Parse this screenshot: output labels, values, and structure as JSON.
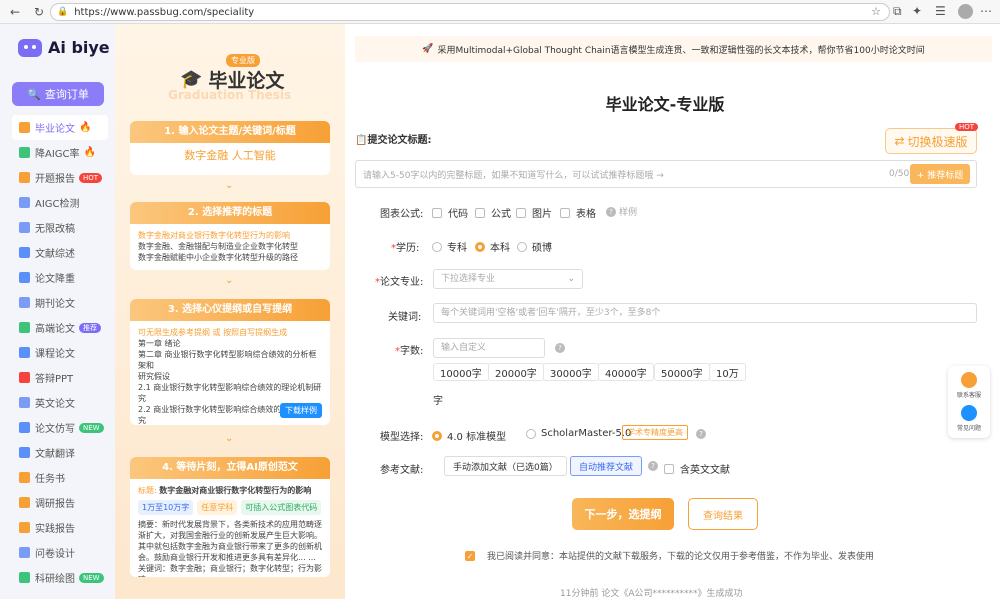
{
  "browser": {
    "url": "https://www.passbug.com/speciality"
  },
  "brand": {
    "name": "Ai biye"
  },
  "sidebar": {
    "search_button": "查询订单",
    "items": [
      {
        "label": "毕业论文",
        "badge": "fire",
        "color": "#f7a035"
      },
      {
        "label": "降AIGC率",
        "badge": "fire",
        "color": "#3cc57a"
      },
      {
        "label": "开题报告",
        "badge": "HOT",
        "color": "#f7a035"
      },
      {
        "label": "AIGC检测",
        "badge": "",
        "color": "#7b9cf6"
      },
      {
        "label": "无限改稿",
        "badge": "",
        "color": "#7b9cf6"
      },
      {
        "label": "文献综述",
        "badge": "",
        "color": "#5b8ff9"
      },
      {
        "label": "论文降重",
        "badge": "",
        "color": "#5b8ff9"
      },
      {
        "label": "期刊论文",
        "badge": "",
        "color": "#7b9cf6"
      },
      {
        "label": "高端论文",
        "badge": "推荐",
        "color": "#3cc57a"
      },
      {
        "label": "课程论文",
        "badge": "",
        "color": "#5b8ff9"
      },
      {
        "label": "答辩PPT",
        "badge": "",
        "color": "#f5443b"
      },
      {
        "label": "英文论文",
        "badge": "",
        "color": "#7b9cf6"
      },
      {
        "label": "论文仿写",
        "badge": "NEW",
        "color": "#5b8ff9"
      },
      {
        "label": "文献翻译",
        "badge": "",
        "color": "#5b8ff9"
      },
      {
        "label": "任务书",
        "badge": "",
        "color": "#f7a035"
      },
      {
        "label": "调研报告",
        "badge": "",
        "color": "#f7a035"
      },
      {
        "label": "实践报告",
        "badge": "",
        "color": "#f7a035"
      },
      {
        "label": "问卷设计",
        "badge": "",
        "color": "#7b9cf6"
      },
      {
        "label": "科研绘图",
        "badge": "NEW",
        "color": "#3cc57a"
      }
    ]
  },
  "left": {
    "badge": "专业版",
    "title": "毕业论文",
    "ghost": "Graduation Thesis",
    "step1": {
      "title": "1. 输入论文主题/关键词/标题",
      "content": "数字金融 人工智能"
    },
    "step2": {
      "title": "2. 选择推荐的标题",
      "lines": [
        "数字金融对商业银行数字化转型行为的影响",
        "数字金融、金融错配与制造业企业数字化转型",
        "数字金融赋能中小企业数字化转型升级的路径"
      ]
    },
    "step3": {
      "title": "3. 选择心仪提纲或自写提纲",
      "hint": "可无限生成参考提纲 或 按照自写提纲生成",
      "lines": [
        "第一章  绪论",
        "第二章  商业银行数字化转型影响综合绩效的分析框架和",
        "研究假设",
        "2.1 商业银行数字化转型影响综合绩效的理论机制研究",
        "2.2 商业银行数字化转型影响综合绩效的传导机制研究",
        "... ..."
      ],
      "button": "下载样例"
    },
    "step4": {
      "title": "4. 等待片刻，立得AI原创范文",
      "label": "标题:",
      "paper_title": "数字金融对商业银行数字化转型行为的影响",
      "tags": [
        "1万至10万字",
        "任意学科",
        "可插入公式图表代码"
      ],
      "abstract": "摘要：新时代发展背景下，各类新技术的应用范畴逐渐扩大，对我国金融行业的创新发展产生巨大影响。其中就包括数字金融为商业银行带来了更多的创新机会。鼓励商业银行开发和推进更多具有差异化... ...",
      "keywords": "关键词：数字金融；商业银行；数字化转型；行为影响"
    }
  },
  "main": {
    "banner": "采用Multimodal+Global Thought Chain语言模型生成连贯、一致和逻辑性强的长文本技术，帮你节省100小时论文时间",
    "title": "毕业论文-专业版",
    "submit_label": "提交论文标题:",
    "switch": "切换极速版",
    "hot": "HOT",
    "title_placeholder": "请输入5-50字以内的完整标题，如果不知道写什么，可以试试推荐标题哦 →",
    "count": "0/50",
    "recommend": "+ 推荐标题",
    "chart_label": "图表公式:",
    "chart_opts": [
      "代码",
      "公式",
      "图片",
      "表格"
    ],
    "sample": "样例",
    "degree_label": "学历:",
    "degrees": [
      "专科",
      "本科",
      "硕博"
    ],
    "major_label": "论文专业:",
    "major_placeholder": "下拉选择专业",
    "kw_label": "关键词:",
    "kw_placeholder": "每个关键词用'空格'或者'回车'隔开，至少3个，至多8个",
    "wc_label": "字数:",
    "wc_placeholder": "输入自定义",
    "wc_opts": [
      "10000字",
      "20000字",
      "30000字",
      "40000字",
      "50000字",
      "10万",
      "字"
    ],
    "model_label": "模型选择:",
    "model1": "4.0 标准模型",
    "model2": "ScholarMaster-5.0",
    "model_tag": "学术专精度更高",
    "ref_label": "参考文献:",
    "ref_manual": "手动添加文献（已选0篇）",
    "ref_auto": "自动推荐文献",
    "ref_en": "含英文文献",
    "next": "下一步，选提纲",
    "query": "查询结果",
    "agree": "我已阅读并同意：本站提供的文献下载服务，下载的论文仅用于参考借鉴，不作为毕业、发表使用",
    "footer": "11分钟前 论文《A公司**********》生成成功"
  },
  "float": {
    "service": "联系客服",
    "faq": "常见问题"
  }
}
